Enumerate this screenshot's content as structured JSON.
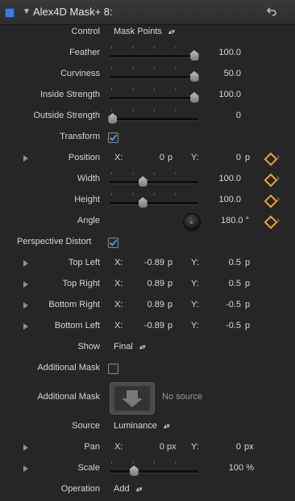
{
  "header": {
    "title": "Alex4D Mask+ 8:"
  },
  "control": {
    "label": "Control",
    "value": "Mask Points"
  },
  "feather": {
    "label": "Feather",
    "value": "100.0",
    "level": 0.95
  },
  "curviness": {
    "label": "Curviness",
    "value": "50.0",
    "level": 0.95
  },
  "inside_strength": {
    "label": "Inside Strength",
    "value": "100.0",
    "level": 0.95
  },
  "outside_strength": {
    "label": "Outside Strength",
    "value": "0",
    "level": 0.03
  },
  "transform": {
    "label": "Transform",
    "checked": true
  },
  "position": {
    "label": "Position",
    "x_label": "X:",
    "x_value": "0",
    "x_unit": "p",
    "y_label": "Y:",
    "y_value": "0",
    "y_unit": "p"
  },
  "width": {
    "label": "Width",
    "value": "100.0",
    "level": 0.37
  },
  "height": {
    "label": "Height",
    "value": "100.0",
    "level": 0.37
  },
  "angle": {
    "label": "Angle",
    "value": "180.0 °"
  },
  "perspective": {
    "label": "Perspective Distort",
    "checked": true
  },
  "top_left": {
    "label": "Top Left",
    "x_label": "X:",
    "x_value": "-0.89",
    "x_unit": "p",
    "y_label": "Y:",
    "y_value": "0.5",
    "y_unit": "p"
  },
  "top_right": {
    "label": "Top Right",
    "x_label": "X:",
    "x_value": "0.89",
    "x_unit": "p",
    "y_label": "Y:",
    "y_value": "0.5",
    "y_unit": "p"
  },
  "bottom_right": {
    "label": "Bottom Right",
    "x_label": "X:",
    "x_value": "0.89",
    "x_unit": "p",
    "y_label": "Y:",
    "y_value": "-0.5",
    "y_unit": "p"
  },
  "bottom_left": {
    "label": "Bottom Left",
    "x_label": "X:",
    "x_value": "-0.89",
    "x_unit": "p",
    "y_label": "Y:",
    "y_value": "-0.5",
    "y_unit": "p"
  },
  "show": {
    "label": "Show",
    "value": "Final"
  },
  "additional_mask_toggle": {
    "label": "Additional Mask",
    "checked": false
  },
  "additional_mask_well": {
    "label": "Additional Mask",
    "empty_text": "No source"
  },
  "source": {
    "label": "Source",
    "value": "Luminance"
  },
  "pan": {
    "label": "Pan",
    "x_label": "X:",
    "x_value": "0",
    "x_unit": "px",
    "y_label": "Y:",
    "y_value": "0",
    "y_unit": "px"
  },
  "scale": {
    "label": "Scale",
    "value": "100 %",
    "level": 0.27
  },
  "operation": {
    "label": "Operation",
    "value": "Add"
  },
  "colors": {
    "accent": "#3b7be0",
    "keyframe": "#e8a530",
    "background": "#262626"
  }
}
